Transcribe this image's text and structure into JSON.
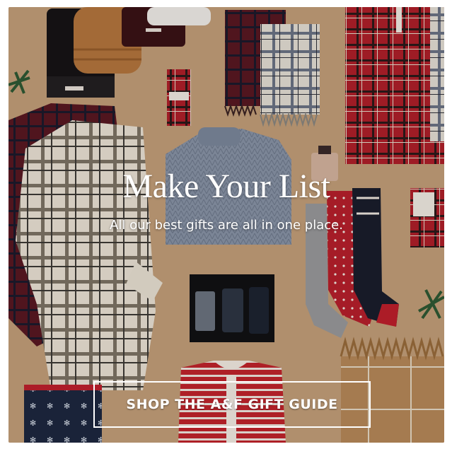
{
  "hero": {
    "headline": "Make Your List",
    "subheadline": "All our best gifts are all in one place.",
    "cta_label": "SHOP THE A&F GIFT GUIDE",
    "background_color": "#c4a07a"
  }
}
